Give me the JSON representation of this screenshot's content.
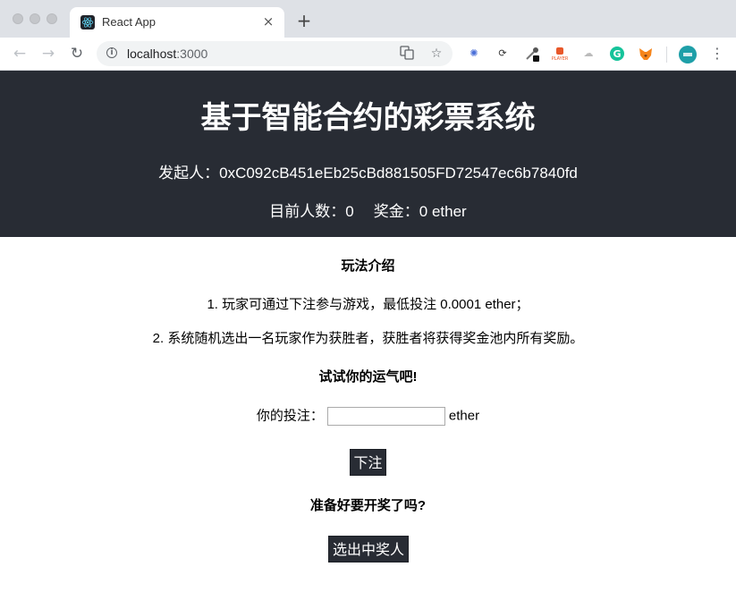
{
  "browser": {
    "tab_title": "React App",
    "tab_close": "×",
    "new_tab": "+",
    "url_host": "localhost",
    "url_port": ":3000",
    "back": "←",
    "forward": "→",
    "reload": "↻",
    "menu": "⋮"
  },
  "header": {
    "title": "基于智能合约的彩票系统",
    "initiator_label": "发起人：",
    "initiator_address": "0xC092cB451eEb25cBd881505FD72547ec6b7840fd",
    "players_label": "目前人数：",
    "players_count": "0",
    "prize_label": "奖金：",
    "prize_amount": "0 ether"
  },
  "rules": {
    "heading": "玩法介绍",
    "rule1": "1. 玩家可通过下注参与游戏，最低投注 0.0001 ether；",
    "rule2": "2. 系统随机选出一名玩家作为获胜者，获胜者将获得奖金池内所有奖励。"
  },
  "bet": {
    "heading": "试试你的运气吧!",
    "label": "你的投注：",
    "value": "",
    "unit": "ether",
    "button": "下注"
  },
  "draw": {
    "heading": "准备好要开奖了吗?",
    "button": "选出中奖人"
  },
  "colors": {
    "header_bg": "#282c34",
    "button_bg": "#282c34"
  }
}
